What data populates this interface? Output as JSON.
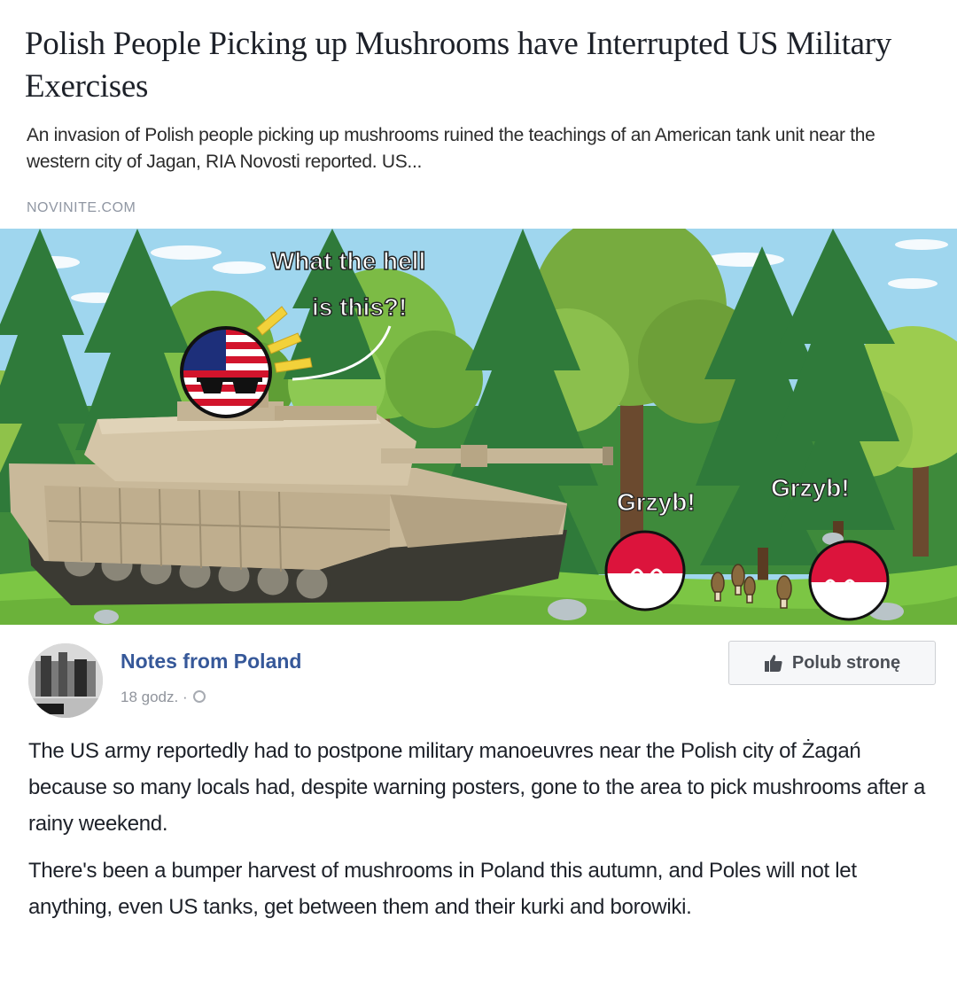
{
  "link_card": {
    "title": "Polish People Picking up Mushrooms have Interrupted US Military Exercises",
    "description": "An invasion of Polish people picking up mushrooms ruined the teachings of an American tank unit near the western city of Jagan, RIA Novosti reported. US...",
    "domain": "NOVINITE.COM"
  },
  "illustration": {
    "usa_speech": [
      "What the hell",
      "is this?!"
    ],
    "poland_left_speech": "Grzyb!",
    "poland_right_speech": "Grzyb!"
  },
  "post": {
    "page_name": "Notes from Poland",
    "time": "18 godz.",
    "meta_separator": "·",
    "like_button_label": "Polub stronę",
    "paragraphs": [
      "The US army reportedly had to postpone military manoeuvres near the Polish city of Żagań because so many locals had, despite warning posters, gone to the area to pick mushrooms after a rainy weekend.",
      "There's been a bumper harvest of mushrooms in Poland this autumn, and Poles will not let anything, even US tanks, get between them and their kurki and borowiki."
    ]
  },
  "colors": {
    "link_blue": "#365899",
    "poland_red": "#dc143c",
    "tank_tan": "#c9b99a"
  },
  "icons": [
    "globe-icon",
    "thumbs-up-icon"
  ]
}
